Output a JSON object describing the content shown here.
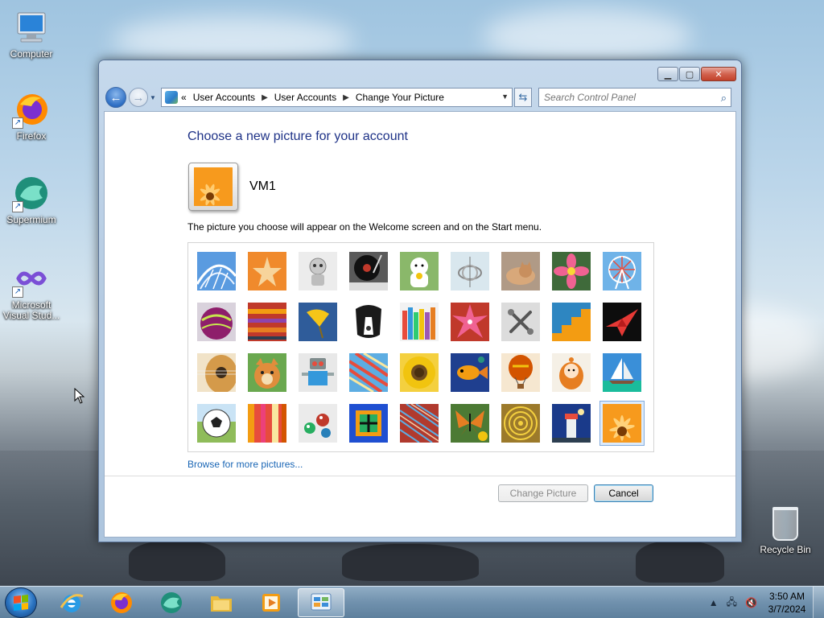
{
  "desktop": {
    "icons": [
      {
        "label": "Computer"
      },
      {
        "label": "Firefox"
      },
      {
        "label": "Supermium"
      },
      {
        "label": "Microsoft Visual Stud..."
      }
    ],
    "recycle_bin": "Recycle Bin"
  },
  "window": {
    "breadcrumb": [
      "User Accounts",
      "User Accounts",
      "Change Your Picture"
    ],
    "breadcrumb_prefix": "«",
    "search_placeholder": "Search Control Panel",
    "heading": "Choose a new picture for your account",
    "username": "VM1",
    "description": "The picture you choose will appear on the Welcome screen and on the Start menu.",
    "browse_link": "Browse for more pictures...",
    "change_button": "Change Picture",
    "cancel_button": "Cancel",
    "pictures": [
      "roller-coaster",
      "starfish",
      "robot-toy",
      "record-player",
      "lucky-cat",
      "gyroscope",
      "kitten",
      "pink-flower",
      "ferris-wheel",
      "ball",
      "fabric",
      "ginkgo-leaf",
      "dog",
      "crayons",
      "paper-star",
      "jacks",
      "stairs",
      "origami-crane",
      "guitar",
      "puppy",
      "tin-robot",
      "knit-fabric",
      "sunflower",
      "fish",
      "balloon",
      "doll",
      "sailboat",
      "soccer-ball",
      "stripes",
      "marbles",
      "window",
      "patterns",
      "butterfly",
      "spiral",
      "lighthouse",
      "daisy"
    ],
    "selected_picture": "daisy"
  },
  "taskbar": {
    "apps": [
      "start",
      "internet-explorer",
      "firefox",
      "supermium",
      "file-explorer",
      "media-player",
      "control-panel"
    ],
    "time": "3:50 AM",
    "date": "3/7/2024"
  }
}
